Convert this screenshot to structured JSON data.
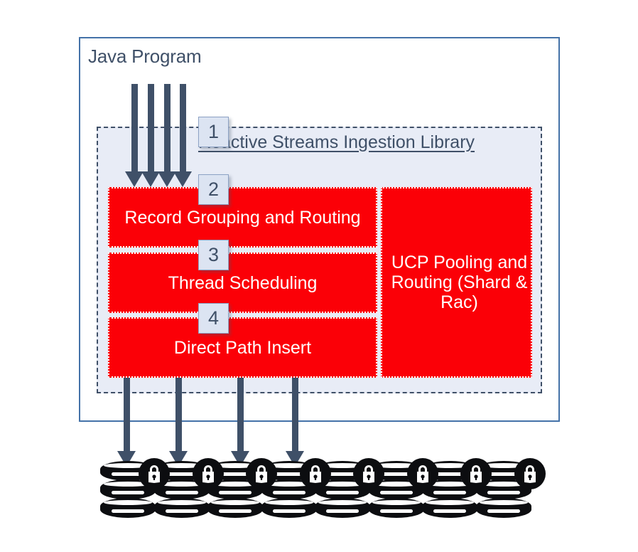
{
  "diagram": {
    "title": "Java Program",
    "library": {
      "label": "Reactive Streams Ingestion Library"
    },
    "modules_left": [
      {
        "step": "2",
        "label": "Record Grouping and Routing"
      },
      {
        "step": "3",
        "label": "Thread Scheduling"
      },
      {
        "step": "4",
        "label": "Direct Path Insert"
      }
    ],
    "module_right": {
      "label": "UCP Pooling and Routing (Shard & Rac)"
    },
    "badges": [
      "1",
      "2",
      "3",
      "4"
    ],
    "inbound_arrows": {
      "count": 4,
      "name": "record-stream-arrow"
    },
    "outbound_arrows": {
      "count": 4,
      "name": "insert-arrow"
    },
    "databases": {
      "count": 8,
      "icon": "database-cylinder-icon",
      "badge_icon": "lock-icon"
    },
    "colors": {
      "module_fill": "#fb0007",
      "module_text": "#ffffff",
      "container_border": "#4472a8",
      "library_fill": "#e8ecf6",
      "library_border": "#3f5068",
      "arrow": "#3f5068",
      "badge_fill": "#dce4f2",
      "badge_text": "#3f5068",
      "database": "#0c0d10",
      "page_background": "#ffffff"
    }
  }
}
